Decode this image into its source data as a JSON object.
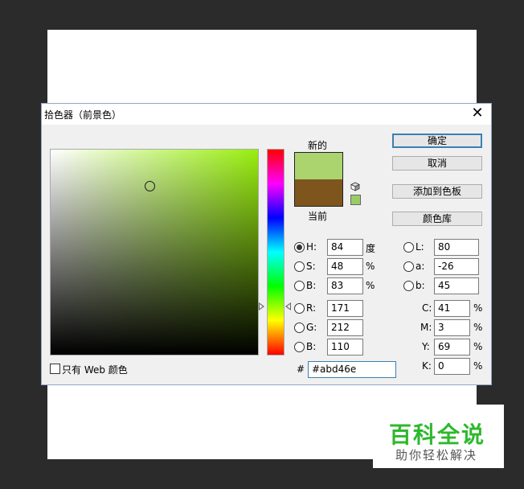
{
  "dialog": {
    "title": "拾色器（前景色）",
    "close_symbol": "✕"
  },
  "preview": {
    "new_label": "新的",
    "current_label": "当前",
    "new_color": "#abd46e",
    "current_color": "#7e561d",
    "web_swatch_color": "#99cc66"
  },
  "buttons": {
    "ok": "确定",
    "cancel": "取消",
    "add_to_swatches": "添加到色板",
    "color_libraries": "颜色库"
  },
  "hsb": {
    "h_label": "H:",
    "h_value": "84",
    "h_unit": "度",
    "s_label": "S:",
    "s_value": "48",
    "s_unit": "%",
    "b_label": "B:",
    "b_value": "83",
    "b_unit": "%",
    "selected": "H"
  },
  "rgb": {
    "r_label": "R:",
    "r_value": "171",
    "g_label": "G:",
    "g_value": "212",
    "b_label": "B:",
    "b_value": "110"
  },
  "lab": {
    "l_label": "L:",
    "l_value": "80",
    "a_label": "a:",
    "a_value": "-26",
    "b_label": "b:",
    "b_value": "45"
  },
  "cmyk": {
    "c_label": "C:",
    "c_value": "41",
    "m_label": "M:",
    "m_value": "3",
    "y_label": "Y:",
    "y_value": "69",
    "k_label": "K:",
    "k_value": "0",
    "unit": "%"
  },
  "hex": {
    "label": "#",
    "value": "#abd46e"
  },
  "web_only": {
    "label": "只有 Web 颜色",
    "checked": false
  },
  "field": {
    "hue_color": "#99ee10"
  },
  "watermark": {
    "title": "百科全说",
    "subtitle": "助你轻松解决"
  }
}
